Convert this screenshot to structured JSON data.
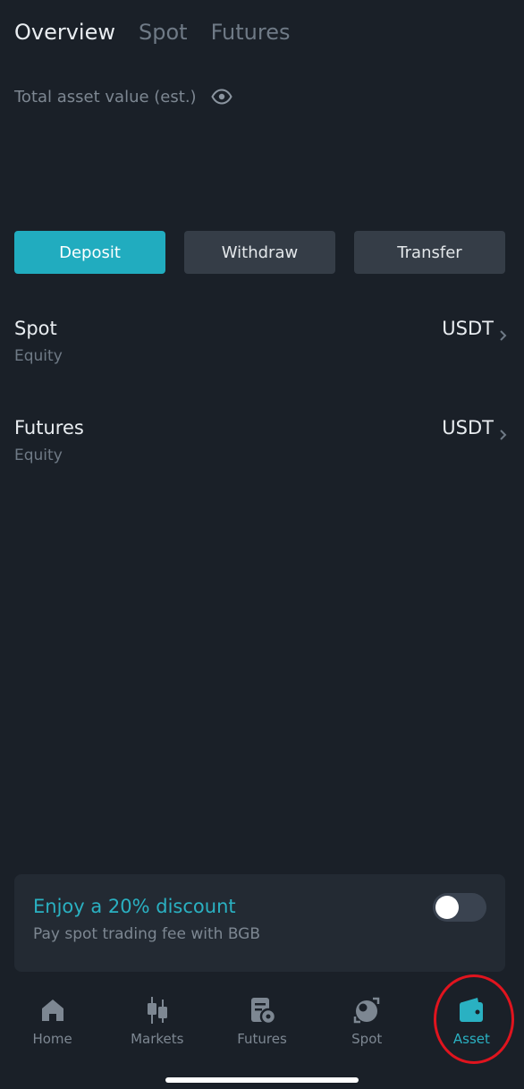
{
  "tabs": [
    {
      "label": "Overview",
      "active": true
    },
    {
      "label": "Spot",
      "active": false
    },
    {
      "label": "Futures",
      "active": false
    }
  ],
  "total_asset": {
    "label": "Total asset value (est.)",
    "icon": "eye-icon"
  },
  "actions": {
    "deposit": "Deposit",
    "withdraw": "Withdraw",
    "transfer": "Transfer"
  },
  "accounts": [
    {
      "name": "Spot",
      "sub": "Equity",
      "currency": "USDT"
    },
    {
      "name": "Futures",
      "sub": "Equity",
      "currency": "USDT"
    }
  ],
  "promo": {
    "title": "Enjoy a 20% discount",
    "subtitle": "Pay spot trading fee with BGB",
    "toggle_on": false
  },
  "nav": [
    {
      "label": "Home",
      "icon": "home-icon",
      "active": false
    },
    {
      "label": "Markets",
      "icon": "markets-icon",
      "active": false
    },
    {
      "label": "Futures",
      "icon": "futures-icon",
      "active": false
    },
    {
      "label": "Spot",
      "icon": "spot-icon",
      "active": false
    },
    {
      "label": "Asset",
      "icon": "wallet-icon",
      "active": true
    }
  ],
  "colors": {
    "background": "#1a2028",
    "accent": "#21acbf",
    "highlight": "#e0141e"
  }
}
